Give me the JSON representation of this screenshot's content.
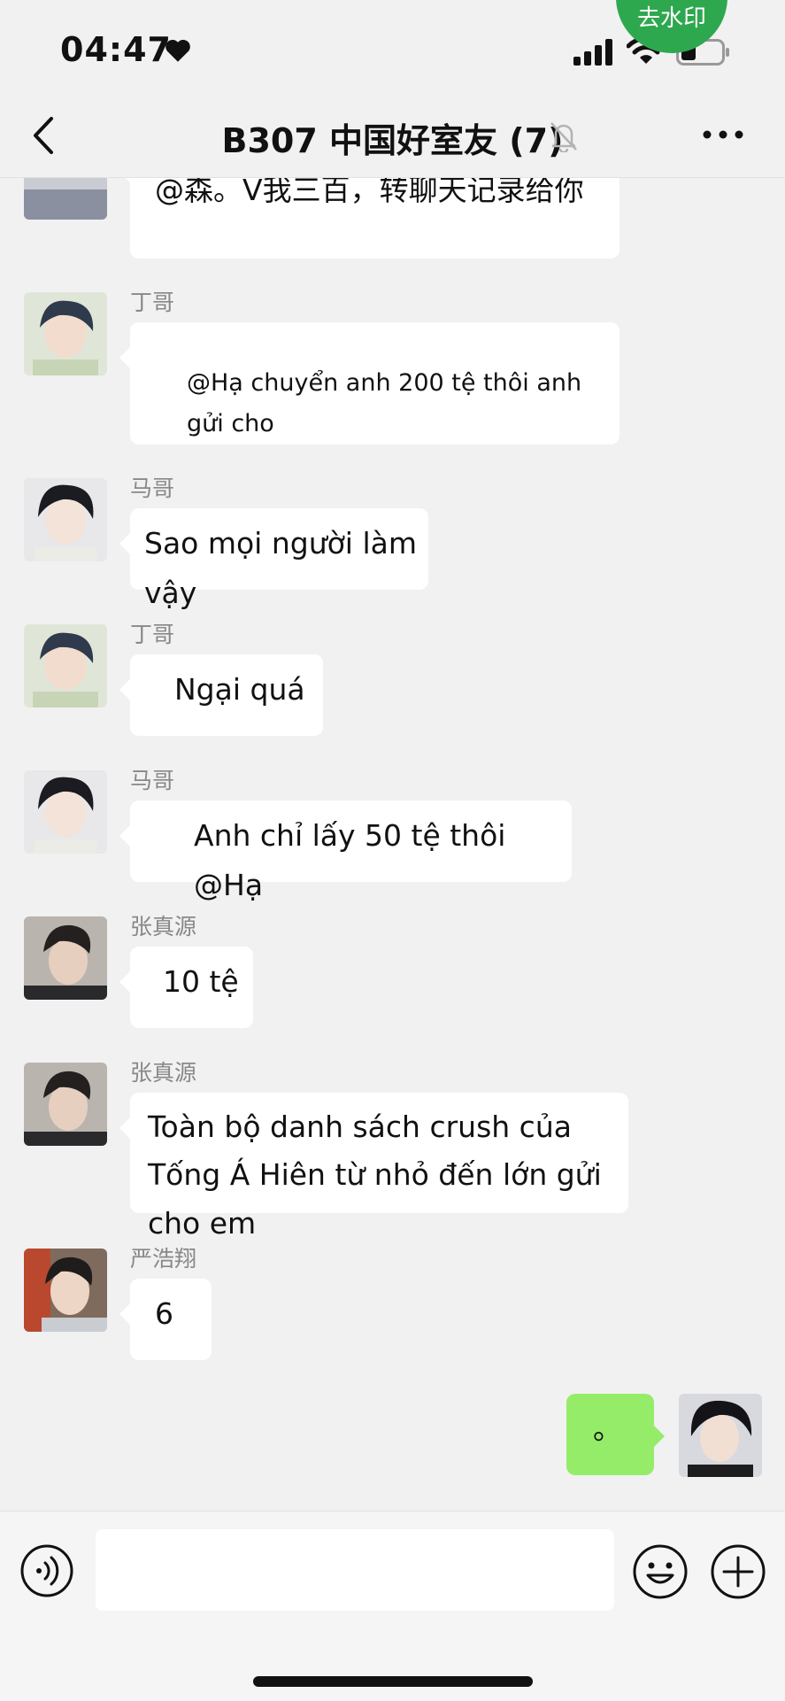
{
  "status_bar": {
    "time": "04:47"
  },
  "watermark_badge": "去水印",
  "header": {
    "title": "B307 中国好室友 (7)"
  },
  "messages": [
    {
      "text": "@森。V我三百，转聊天记录给你"
    },
    {
      "sender": "丁哥",
      "text": "@Hạ chuyển anh 200 tệ thôi anh gửi cho"
    },
    {
      "sender": "马哥",
      "text": "Sao mọi người làm vậy"
    },
    {
      "sender": "丁哥",
      "text": "Ngại quá"
    },
    {
      "sender": "马哥",
      "text": "Anh chỉ lấy 50 tệ thôi @Hạ"
    },
    {
      "sender": "张真源",
      "text": "10 tệ"
    },
    {
      "sender": "张真源",
      "text": "Toàn bộ danh sách crush của Tống Á Hiên từ nhỏ đến lớn gửi cho em"
    },
    {
      "sender": "严浩翔",
      "text": "6"
    },
    {
      "text": "。"
    }
  ],
  "icons": {
    "heart": "heart-icon",
    "signal": "cellular-signal-icon",
    "wifi": "wifi-icon",
    "battery": "battery-icon",
    "back": "chevron-left-icon",
    "mute": "bell-muted-icon",
    "more": "more-dots-icon",
    "voice": "voice-input-icon",
    "emoji": "emoji-icon",
    "plus": "plus-icon"
  },
  "colors": {
    "background": "#f1f1f1",
    "bubble_received": "#ffffff",
    "bubble_sent": "#95ec69",
    "badge": "#2ea84f"
  }
}
